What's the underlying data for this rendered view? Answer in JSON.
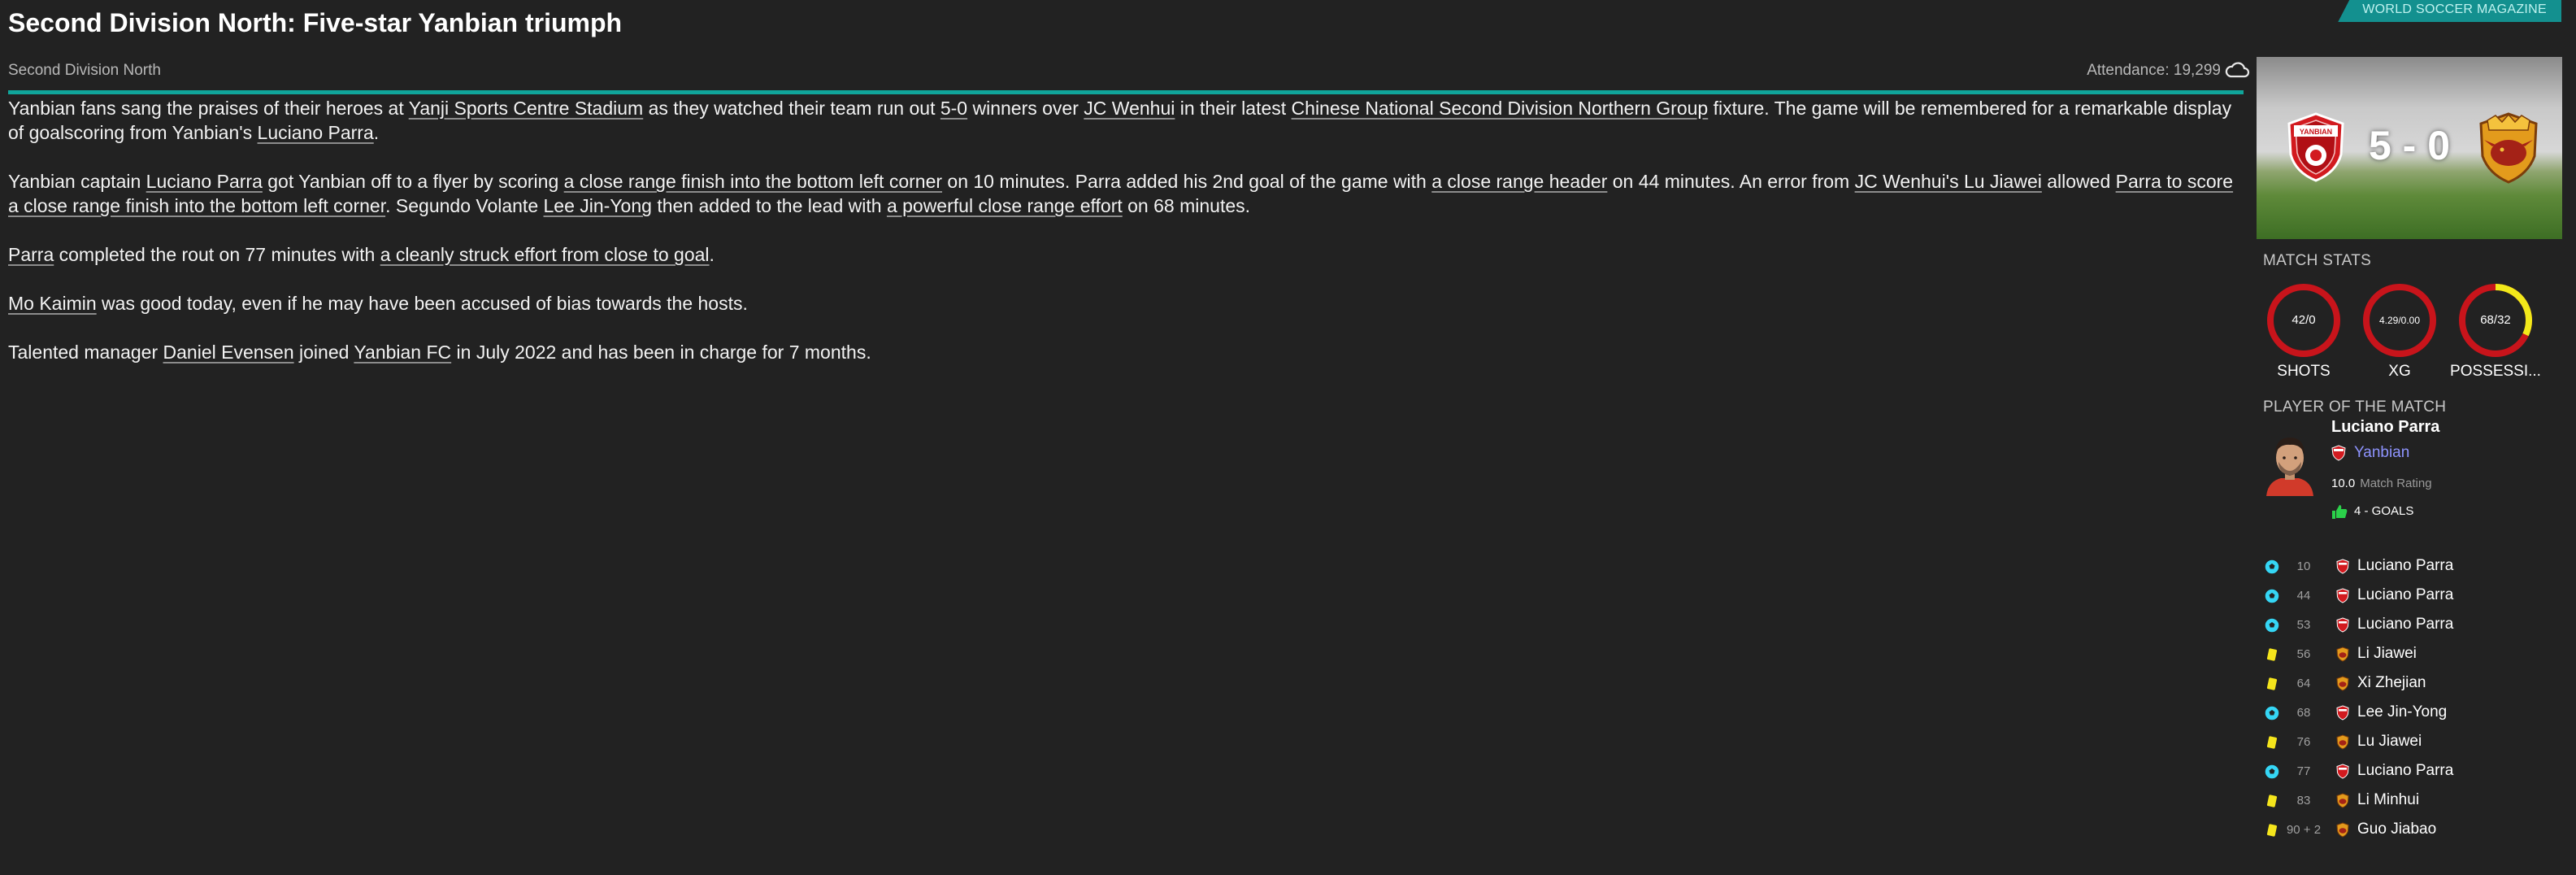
{
  "header": {
    "title": "Second Division North: Five-star Yanbian triumph",
    "brand": "WORLD SOCCER MAGAZINE",
    "competition": "Second Division North",
    "attendance": "Attendance: 19,299"
  },
  "article": {
    "p1": {
      "t1": "Yanbian fans sang the praises of their heroes at ",
      "l1": "Yanji Sports Centre Stadium",
      "t2": " as they watched their team run out ",
      "l2": "5-0",
      "t3": " winners over ",
      "l3": "JC Wenhui",
      "t4": " in their latest ",
      "l4": "Chinese National Second Division Northern Group",
      "t5": " fixture. The game will be remembered for a remarkable display of goalscoring from Yanbian's ",
      "l5": "Luciano Parra",
      "t6": "."
    },
    "p2": {
      "t1": "Yanbian captain ",
      "l1": "Luciano Parra",
      "t2": " got Yanbian off to a flyer by scoring ",
      "l2": "a close range finish into the bottom left corner",
      "t3": " on 10 minutes. Parra added his 2nd goal of the game with ",
      "l3": "a close range header",
      "t4": " on 44 minutes. An error from ",
      "l4": "JC Wenhui's Lu Jiawei",
      "t5": " allowed ",
      "l5": "Parra to score a close range finish into the bottom left corner",
      "t6": ". Segundo Volante ",
      "l6": "Lee Jin-Yong",
      "t7": " then added to the lead with ",
      "l7": "a powerful close range effort",
      "t8": " on 68 minutes."
    },
    "p3": {
      "l1": "Parra",
      "t1": " completed the rout on 77 minutes with ",
      "l2": "a cleanly struck effort from close to goal",
      "t2": "."
    },
    "p4": {
      "l1": "Mo Kaimin",
      "t1": " was good today, even if he may have been accused of bias towards the hosts."
    },
    "p5": {
      "t1": "Talented manager ",
      "l1": "Daniel Evensen",
      "t2": " joined ",
      "l2": "Yanbian FC",
      "t3": " in July 2022 and has been in charge for 7 months."
    }
  },
  "sidebar": {
    "score": "5 - 0",
    "home_crest_text": "YANBIAN",
    "stats_title": "MATCH STATS",
    "stats": [
      {
        "label": "SHOTS",
        "value": "42/0",
        "fraction": 1.0
      },
      {
        "label": "XG",
        "value": "4.29/0.00",
        "fraction": 1.0
      },
      {
        "label": "POSSESSI...",
        "value": "68/32",
        "fraction": 0.68
      }
    ],
    "potm_title": "PLAYER OF THE MATCH",
    "potm": {
      "name": "Luciano Parra",
      "team": "Yanbian",
      "rating": "10.0",
      "rating_label": "Match Rating",
      "goals": "4 - GOALS"
    },
    "events": [
      {
        "icon": "goal-icon",
        "minute": "10",
        "team": "home",
        "player": "Luciano Parra"
      },
      {
        "icon": "goal-icon",
        "minute": "44",
        "team": "home",
        "player": "Luciano Parra"
      },
      {
        "icon": "goal-icon",
        "minute": "53",
        "team": "home",
        "player": "Luciano Parra"
      },
      {
        "icon": "yellow-card-icon",
        "minute": "56",
        "team": "away",
        "player": "Li Jiawei"
      },
      {
        "icon": "yellow-card-icon",
        "minute": "64",
        "team": "away",
        "player": "Xi Zhejian"
      },
      {
        "icon": "goal-icon",
        "minute": "68",
        "team": "home",
        "player": "Lee Jin-Yong"
      },
      {
        "icon": "yellow-card-icon",
        "minute": "76",
        "team": "away",
        "player": "Lu Jiawei"
      },
      {
        "icon": "goal-icon",
        "minute": "77",
        "team": "home",
        "player": "Luciano Parra"
      },
      {
        "icon": "yellow-card-icon",
        "minute": "83",
        "team": "away",
        "player": "Li Minhui"
      },
      {
        "icon": "yellow-card-icon",
        "minute": "90 + 2",
        "team": "away",
        "player": "Guo Jiabao"
      }
    ]
  },
  "colors": {
    "accent": "#10a59a",
    "gauge_home": "#c8141b",
    "gauge_away": "#f2e91a",
    "goal_icon": "#35d6f5",
    "yellow_card": "#f5e51c",
    "link_team": "#8e94ff"
  }
}
